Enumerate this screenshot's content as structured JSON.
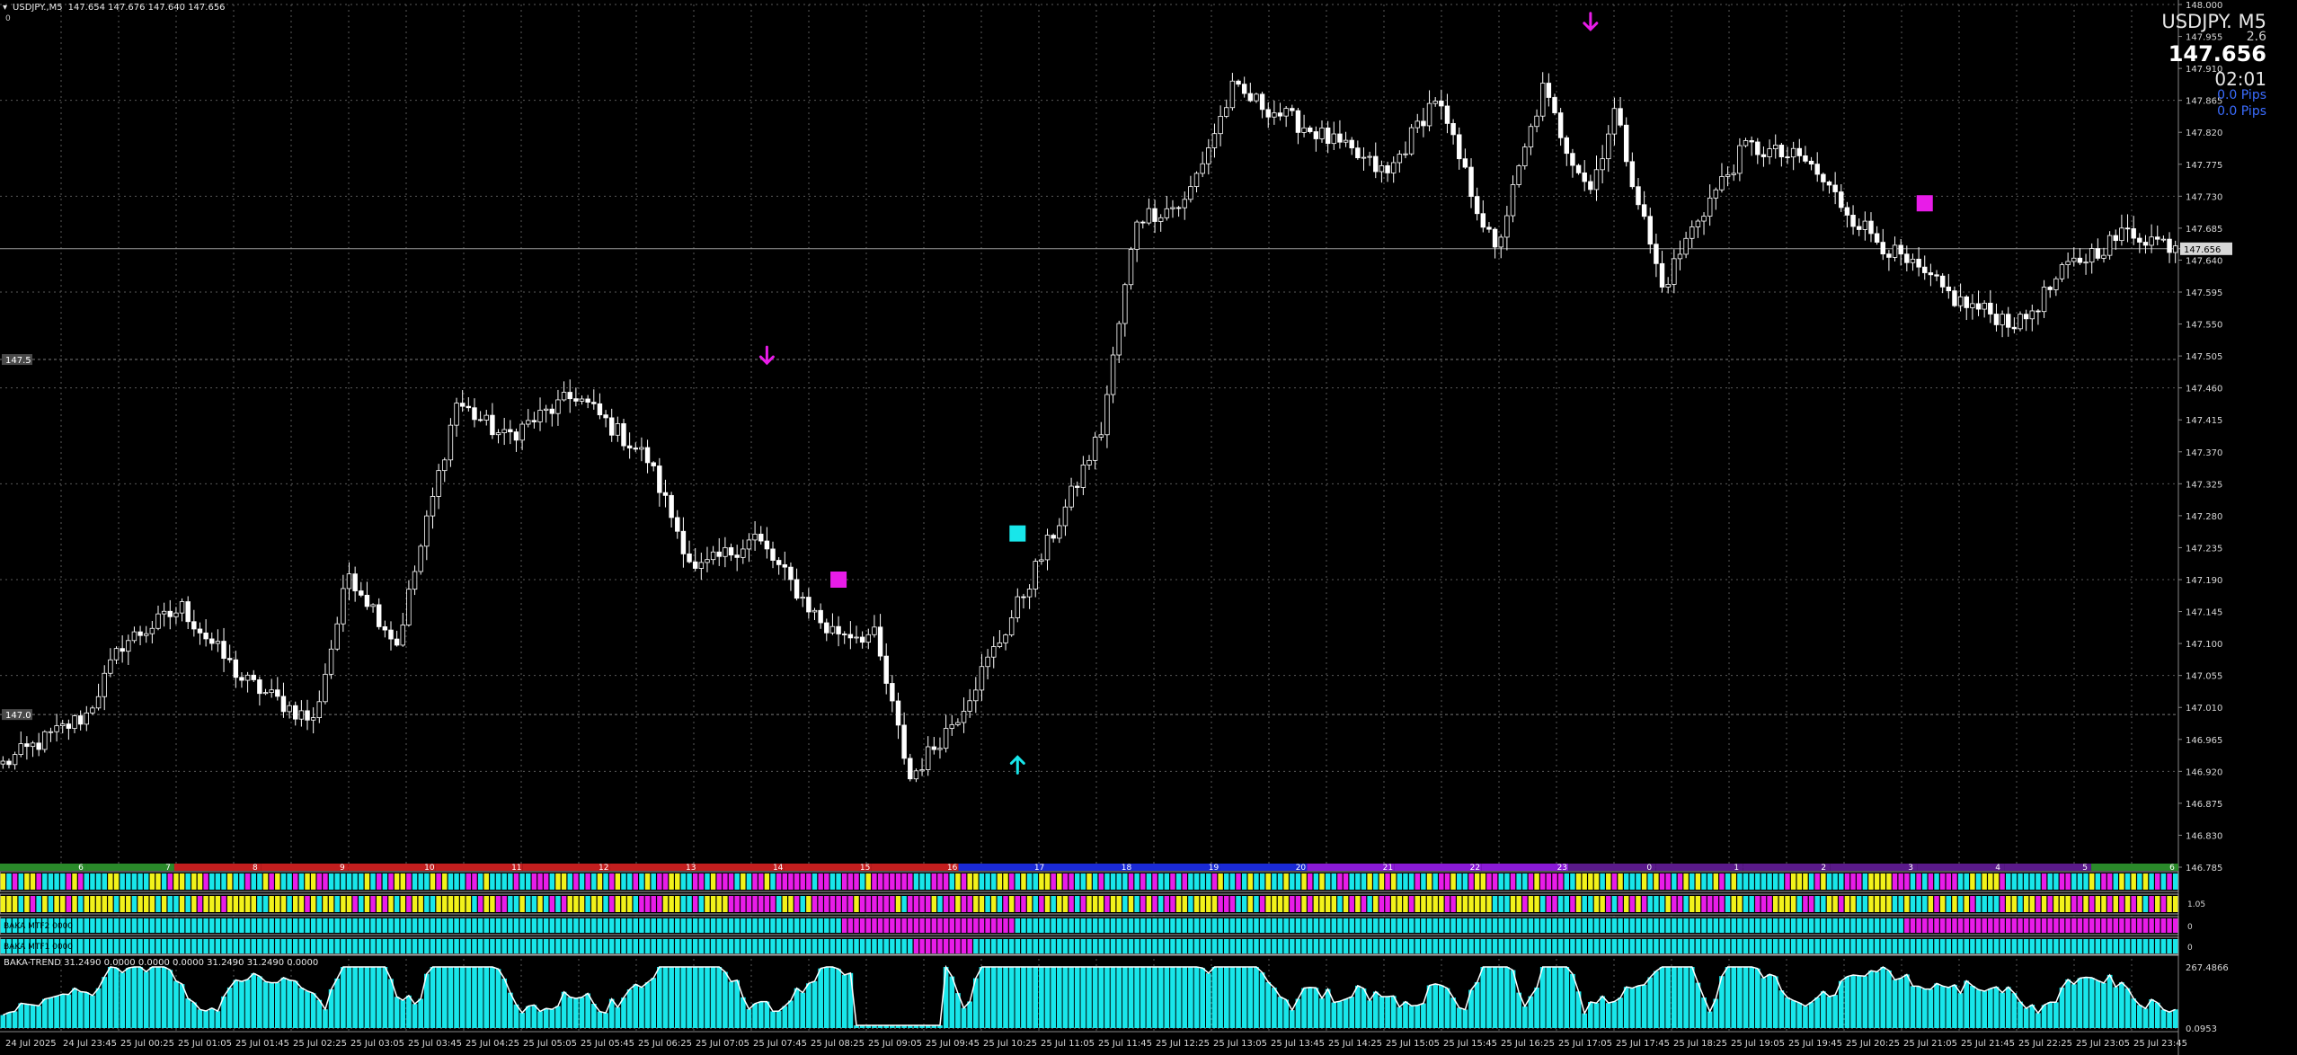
{
  "window": {
    "symbol_tf": "USDJPY.,M5",
    "ohlc": "147.654 147.676 147.640 147.656",
    "top_left_zero": "0"
  },
  "overlay": {
    "symbol": "USDJPY.  M5",
    "spread": "2.6",
    "price": "147.656",
    "timer": "02:01",
    "pips_1": "0.0 Pips",
    "pips_2": "0.0 Pips"
  },
  "chart_data": {
    "type": "candlestick",
    "ylim": [
      146.785,
      148.0
    ],
    "y_ticks": [
      "148.000",
      "147.955",
      "147.910",
      "147.865",
      "147.820",
      "147.775",
      "147.730",
      "147.685",
      "147.640",
      "147.595",
      "147.550",
      "147.505",
      "147.460",
      "147.415",
      "147.370",
      "147.325",
      "147.280",
      "147.235",
      "147.190",
      "147.145",
      "147.100",
      "147.055",
      "147.010",
      "146.965",
      "146.920",
      "146.875",
      "146.830",
      "146.785"
    ],
    "current_price": 147.656,
    "current_price_label": "147.656",
    "levels": [
      {
        "value": 147.5,
        "label": "147.5"
      },
      {
        "value": 147.0,
        "label": "147.0"
      }
    ],
    "x_labels": [
      "24 Jul 2025",
      "24 Jul 23:45",
      "25 Jul 00:25",
      "25 Jul 01:05",
      "25 Jul 01:45",
      "25 Jul 02:25",
      "25 Jul 03:05",
      "25 Jul 03:45",
      "25 Jul 04:25",
      "25 Jul 05:05",
      "25 Jul 05:45",
      "25 Jul 06:25",
      "25 Jul 07:05",
      "25 Jul 07:45",
      "25 Jul 08:25",
      "25 Jul 09:05",
      "25 Jul 09:45",
      "25 Jul 10:25",
      "25 Jul 11:05",
      "25 Jul 11:45",
      "25 Jul 12:25",
      "25 Jul 13:05",
      "25 Jul 13:45",
      "25 Jul 14:25",
      "25 Jul 15:05",
      "25 Jul 15:45",
      "25 Jul 16:25",
      "25 Jul 17:05",
      "25 Jul 17:45",
      "25 Jul 18:25",
      "25 Jul 19:05",
      "25 Jul 19:45",
      "25 Jul 20:25",
      "25 Jul 21:05",
      "25 Jul 21:45",
      "25 Jul 22:25",
      "25 Jul 23:05",
      "25 Jul 23:45"
    ],
    "anchors": [
      [
        0,
        146.93
      ],
      [
        8,
        146.97
      ],
      [
        14,
        147.0
      ],
      [
        20,
        147.1
      ],
      [
        30,
        147.15
      ],
      [
        40,
        147.05
      ],
      [
        52,
        146.99
      ],
      [
        58,
        147.2
      ],
      [
        66,
        147.1
      ],
      [
        76,
        147.44
      ],
      [
        84,
        147.39
      ],
      [
        96,
        147.45
      ],
      [
        108,
        147.36
      ],
      [
        116,
        147.2
      ],
      [
        126,
        147.25
      ],
      [
        138,
        147.12
      ],
      [
        146,
        147.11
      ],
      [
        152,
        146.91
      ],
      [
        160,
        147.0
      ],
      [
        168,
        147.12
      ],
      [
        178,
        147.29
      ],
      [
        184,
        147.4
      ],
      [
        190,
        147.7
      ],
      [
        198,
        147.72
      ],
      [
        206,
        147.88
      ],
      [
        220,
        147.82
      ],
      [
        232,
        147.76
      ],
      [
        240,
        147.87
      ],
      [
        250,
        147.65
      ],
      [
        258,
        147.88
      ],
      [
        262,
        147.8
      ],
      [
        266,
        147.74
      ],
      [
        270,
        147.85
      ],
      [
        278,
        147.6
      ],
      [
        284,
        147.7
      ],
      [
        292,
        147.8
      ],
      [
        302,
        147.78
      ],
      [
        310,
        147.7
      ],
      [
        318,
        147.64
      ],
      [
        328,
        147.58
      ],
      [
        338,
        147.55
      ],
      [
        346,
        147.63
      ],
      [
        356,
        147.68
      ],
      [
        364,
        147.66
      ]
    ],
    "markers": [
      {
        "type": "arrow-down",
        "color": "#e81ce8",
        "bar": 128,
        "price": 147.505
      },
      {
        "type": "square",
        "color": "#e81ce8",
        "bar": 140,
        "price": 147.19
      },
      {
        "type": "square",
        "color": "#18e6ea",
        "bar": 170,
        "price": 147.255
      },
      {
        "type": "arrow-up",
        "color": "#18e6ea",
        "bar": 170,
        "price": 146.93
      },
      {
        "type": "arrow-down",
        "color": "#e81ce8",
        "bar": 266,
        "price": 147.975
      },
      {
        "type": "square",
        "color": "#e81ce8",
        "bar": 322,
        "price": 147.72
      }
    ]
  },
  "session_bar": {
    "hours": [
      "6",
      "7",
      "8",
      "9",
      "10",
      "11",
      "12",
      "13",
      "14",
      "15",
      "16",
      "17",
      "18",
      "19",
      "20",
      "21",
      "22",
      "23",
      "0",
      "1",
      "2",
      "3",
      "4",
      "5",
      "6"
    ]
  },
  "indicators": {
    "rows": [
      {
        "label": "",
        "right_value": ""
      },
      {
        "label": "",
        "right_value": "1.05"
      },
      {
        "label": "BAKA MTF2 0000",
        "right_value": "0"
      },
      {
        "label": "BAKA MTF1 0000",
        "right_value": "0"
      }
    ],
    "trend": {
      "label": "BAKA-TREND  31.2490 0.0000 0.0000 0.0000 31.2490 31.2490 0.0000",
      "max_label": "267.4866",
      "min_label": "0.0953"
    }
  },
  "colors": {
    "cyan": "#18e6ea",
    "magenta": "#e81ce8",
    "yellow": "#f2f21a",
    "candle": "#ffffff",
    "grid": "#5a5a5a"
  }
}
